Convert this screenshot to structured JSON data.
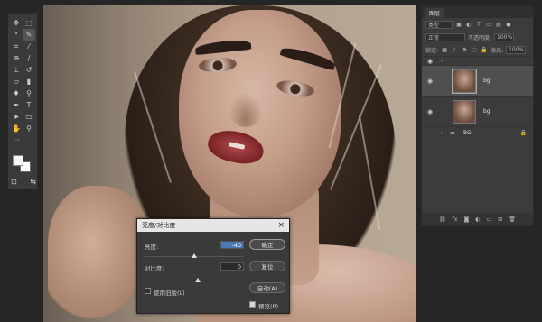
{
  "toolbar": {
    "tools": [
      {
        "name": "move-tool",
        "glyph": "✥"
      },
      {
        "name": "artboard-tool",
        "glyph": "⬚"
      },
      {
        "name": "lasso-tool",
        "glyph": "ᐤ"
      },
      {
        "name": "quick-select-tool",
        "glyph": "✎"
      },
      {
        "name": "crop-tool",
        "glyph": "⌗"
      },
      {
        "name": "eyedropper-tool",
        "glyph": "⁄"
      },
      {
        "name": "healing-tool",
        "glyph": "⊕"
      },
      {
        "name": "brush-tool",
        "glyph": "∕"
      },
      {
        "name": "stamp-tool",
        "glyph": "⊥"
      },
      {
        "name": "history-brush-tool",
        "glyph": "↺"
      },
      {
        "name": "eraser-tool",
        "glyph": "▱"
      },
      {
        "name": "gradient-tool",
        "glyph": "▮"
      },
      {
        "name": "blur-tool",
        "glyph": "♦"
      },
      {
        "name": "dodge-tool",
        "glyph": "⚲"
      },
      {
        "name": "pen-tool",
        "glyph": "✒"
      },
      {
        "name": "type-tool",
        "glyph": "T"
      },
      {
        "name": "path-select-tool",
        "glyph": "➤"
      },
      {
        "name": "shape-tool",
        "glyph": "▭"
      },
      {
        "name": "hand-tool",
        "glyph": "✋"
      },
      {
        "name": "zoom-tool",
        "glyph": "⚲"
      },
      {
        "name": "more-tools",
        "glyph": "···"
      }
    ],
    "bottom_left": "⊡",
    "bottom_right": "⇆"
  },
  "layers_panel": {
    "tab": "图层",
    "filter_label": "类型",
    "blend_mode": "正常",
    "opacity_label": "不透明度:",
    "opacity_value": "100%",
    "lock_label": "锁定:",
    "fill_label": "填充:",
    "fill_value": "100%",
    "layers": [
      {
        "name": "bg",
        "active": true
      },
      {
        "name": "bg",
        "active": false
      }
    ],
    "group_name": "BG",
    "footer_icons": [
      "⛓",
      "fx",
      "◙",
      "◐",
      "▭",
      "⊞",
      "🗑"
    ]
  },
  "dialog": {
    "title": "亮度/对比度",
    "close": "×",
    "brightness_label": "亮度:",
    "brightness_value": "-40",
    "contrast_label": "对比度:",
    "contrast_value": "0",
    "legacy_label": "使用旧版(L)",
    "preview_label": "预览(P)",
    "ok": "确定",
    "reset": "复位",
    "auto": "自动(A)"
  }
}
